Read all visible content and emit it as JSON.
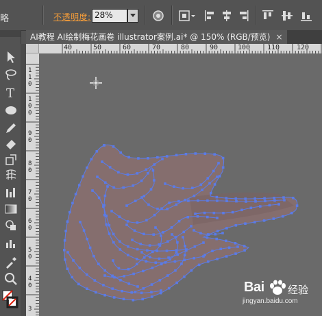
{
  "ctrl": {
    "edge_char": "略",
    "opacity_label": "不透明度:",
    "opacity_value": "28%",
    "icons": [
      "recolor-icon",
      "align-dropdown-icon",
      "align-left-icon",
      "align-center-icon",
      "align-right-icon",
      "align-top-icon",
      "align-middle-icon",
      "align-bottom-icon"
    ]
  },
  "document": {
    "tab_title": "AI教程 AI绘制梅花画卷 illustrator案例.ai* @ 150% (RGB/预览)",
    "close_glyph": "×"
  },
  "tools": [
    "selection-tool",
    "direct-selection-tool",
    "lasso-tool",
    "type-tool",
    "ellipse-tool",
    "pencil-tool",
    "eraser-tool",
    "scale-tool",
    "mesh-tool",
    "graph-tool",
    "gradient-tool",
    "shape-builder-tool",
    "column-graph-tool",
    "eyedropper-tool",
    "zoom-tool",
    "fill-stroke-swatch"
  ],
  "ruler": {
    "h_labels": [
      "40",
      "50",
      "60",
      "70",
      "80",
      "90",
      "100",
      "110",
      "120"
    ],
    "v_labels": [
      "1\n1\n0",
      "1\n0\n0",
      "9\n0",
      "8\n0",
      "7\n0",
      "6\n0",
      "5\n0",
      "4\n0",
      "3"
    ]
  },
  "watermark": {
    "brand": "Bai",
    "brand_suffix": "经验",
    "url": "jingyan.baidu.com"
  },
  "colors": {
    "opacity_label": "#f39c3a",
    "path_stroke": "#5b7be6",
    "shape_fill": "#8a6e6e",
    "canvas_bg": "#6a6a6a"
  }
}
